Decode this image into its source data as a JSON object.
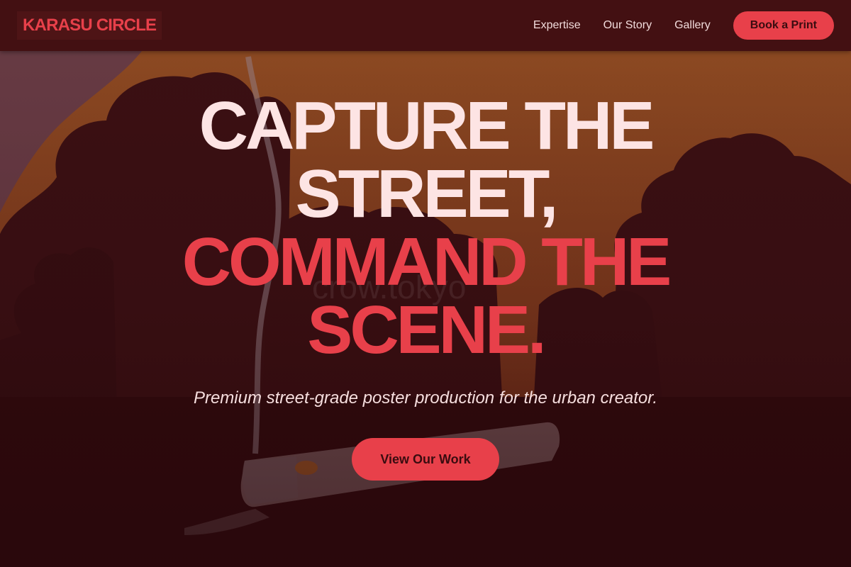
{
  "nav": {
    "brand": "KARASU CIRCLE",
    "links": [
      "Expertise",
      "Our Story",
      "Gallery"
    ],
    "cta": "Book a Print"
  },
  "hero": {
    "headline_light": [
      "CAPTURE THE",
      "STREET,"
    ],
    "headline_accent": [
      "COMMAND THE",
      "SCENE."
    ],
    "subtitle": "Premium street-grade poster production for the urban creator.",
    "cta": "View Our Work"
  },
  "background": {
    "watermark": "crow.tokyo",
    "icons": [
      "cigarette-icon"
    ]
  },
  "colors": {
    "accent": "#e8404a",
    "nav_bg": "#431012",
    "headline_light": "#fde4e4",
    "sky_orange": "#b5612c"
  }
}
